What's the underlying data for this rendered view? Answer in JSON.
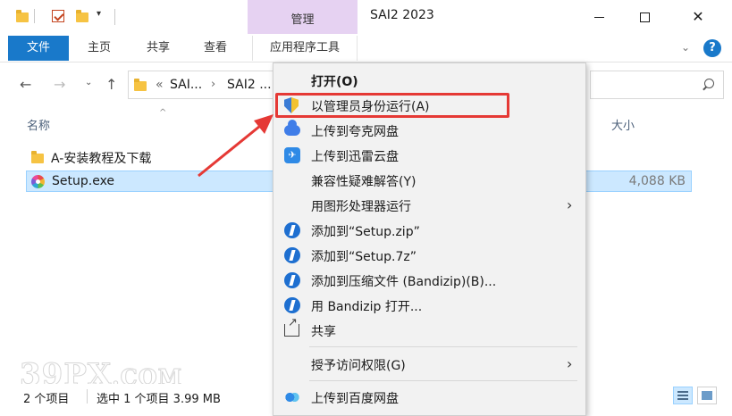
{
  "titlebar": {
    "context_tab": "管理",
    "title": "SAI2 2023"
  },
  "ribbon": {
    "tabs": [
      "文件",
      "主页",
      "共享",
      "查看",
      "应用程序工具"
    ],
    "help": "?"
  },
  "address": {
    "segments": [
      "SAI...",
      "SAI2 ..."
    ],
    "overflow": "«"
  },
  "list": {
    "columns": {
      "name": "名称",
      "size": "大小"
    },
    "rows": [
      {
        "name": "A-安装教程及下载",
        "size": "",
        "type": "folder",
        "selected": false
      },
      {
        "name": "Setup.exe",
        "size": "4,088 KB",
        "type": "exe",
        "selected": true
      }
    ]
  },
  "status": {
    "items": "2 个项目",
    "selection": "选中 1 个项目  3.99 MB"
  },
  "watermark": "39PX.COM",
  "context_menu": {
    "items": [
      {
        "label": "打开(O)",
        "bold": true,
        "icon": "",
        "submenu": false
      },
      {
        "label": "以管理员身份运行(A)",
        "icon": "shield-icon",
        "submenu": false,
        "highlighted": true
      },
      {
        "label": "上传到夸克网盘",
        "icon": "quark-cloud-icon",
        "submenu": false
      },
      {
        "label": "上传到迅雷云盘",
        "icon": "thunder-cloud-icon",
        "submenu": false
      },
      {
        "label": "兼容性疑难解答(Y)",
        "icon": "",
        "submenu": false
      },
      {
        "label": "用图形处理器运行",
        "icon": "",
        "submenu": true
      },
      {
        "label": "添加到“Setup.zip”",
        "icon": "bandizip-icon",
        "submenu": false
      },
      {
        "label": "添加到“Setup.7z”",
        "icon": "bandizip-icon",
        "submenu": false
      },
      {
        "label": "添加到压缩文件 (Bandizip)(B)...",
        "icon": "bandizip-icon",
        "submenu": false
      },
      {
        "label": "用 Bandizip 打开...",
        "icon": "bandizip-icon",
        "submenu": false
      },
      {
        "label": "共享",
        "icon": "share-icon",
        "submenu": false
      },
      {
        "label": "授予访问权限(G)",
        "icon": "",
        "submenu": true
      },
      {
        "label": "上传到百度网盘",
        "icon": "baidu-cloud-icon",
        "submenu": false
      }
    ]
  },
  "colors": {
    "file_tab": "#1979ca",
    "manage_tab": "#e6d2f2",
    "selection": "#cce8ff",
    "highlight_border": "#e53935"
  }
}
